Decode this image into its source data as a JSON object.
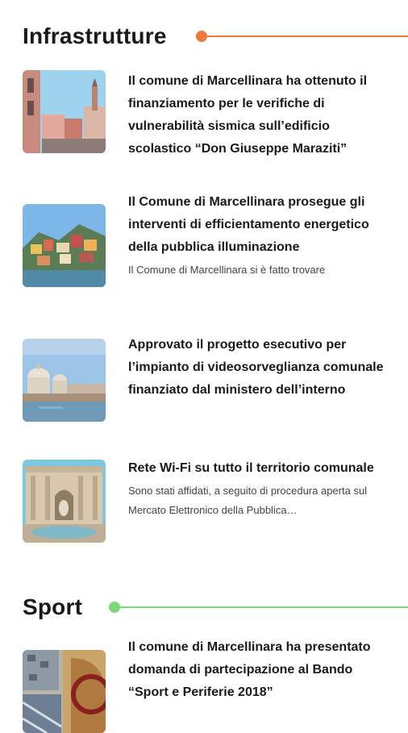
{
  "colors": {
    "infrastrutture_accent": "#F07A3A",
    "sport_accent": "#7ED87A"
  },
  "sections": [
    {
      "title": "Infrastrutture",
      "items": [
        {
          "image_icon": "city-street-photo",
          "title": "Il comune di Marcellinara ha ottenuto il finanziamento per le verifiche di vulnerabilità sismica sull’edificio scolastico “Don Giuseppe Maraziti”",
          "description": ""
        },
        {
          "image_icon": "coastal-village-photo",
          "title": "Il Comune di Marcellinara prosegue gli interventi di efficientamento energetico della pubblica illuminazione",
          "description": "Il Comune di Marcellinara si è fatto trovare"
        },
        {
          "image_icon": "venice-canal-photo",
          "title": "Approvato il progetto esecutivo per l’impianto di videosorveglianza comunale finanziato dal ministero dell’interno",
          "description": ""
        },
        {
          "image_icon": "fountain-monument-photo",
          "title": "Rete Wi-Fi su tutto il territorio comunale",
          "description": "Sono stati affidati, a seguito di procedura aperta sul Mercato Elettronico della Pubblica…"
        }
      ]
    },
    {
      "title": "Sport",
      "items": [
        {
          "image_icon": "sports-field-photo",
          "title": "Il comune di Marcellinara ha presentato domanda di partecipazione al Bando “Sport e Periferie 2018”",
          "description": ""
        }
      ]
    }
  ]
}
